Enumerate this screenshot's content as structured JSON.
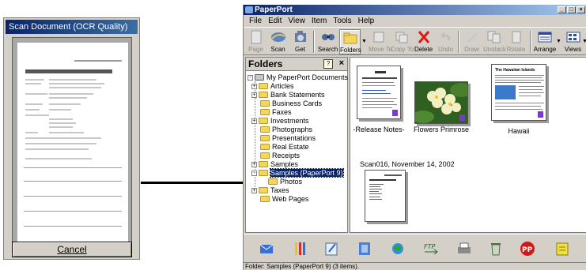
{
  "scan_dialog": {
    "title": "Scan Document (OCR Quality)",
    "cancel_label": "Cancel"
  },
  "paperport": {
    "window_title": "PaperPort",
    "window_buttons": [
      "_",
      "□",
      "×"
    ],
    "menu": [
      "File",
      "Edit",
      "View",
      "Item",
      "Tools",
      "Help"
    ],
    "toolbar": {
      "page": "Page",
      "scan": "Scan",
      "get": "Get",
      "search": "Search",
      "folders": "Folders",
      "move_to": "Move To",
      "copy_to": "Copy To",
      "delete": "Delete",
      "undo": "Undo",
      "draw": "Draw",
      "unstack": "Unstack",
      "rotate": "Rotate",
      "arrange": "Arrange",
      "views": "Views"
    },
    "folders_pane": {
      "title": "Folders",
      "help": "?",
      "close": "×",
      "root": "My PaperPort Documents",
      "items": [
        {
          "label": "Articles",
          "expander": "+"
        },
        {
          "label": "Bank Statements",
          "expander": "+"
        },
        {
          "label": "Business Cards",
          "expander": ""
        },
        {
          "label": "Faxes",
          "expander": ""
        },
        {
          "label": "Investments",
          "expander": "+"
        },
        {
          "label": "Photographs",
          "expander": ""
        },
        {
          "label": "Presentations",
          "expander": ""
        },
        {
          "label": "Real Estate",
          "expander": ""
        },
        {
          "label": "Receipts",
          "expander": ""
        },
        {
          "label": "Samples",
          "expander": "+"
        },
        {
          "label": "Samples (PaperPort 9)",
          "expander": "-",
          "selected": true
        },
        {
          "label": "Photos",
          "expander": "",
          "child": true
        },
        {
          "label": "Taxes",
          "expander": "+"
        },
        {
          "label": "Web Pages",
          "expander": ""
        }
      ]
    },
    "desktop": {
      "items": [
        {
          "caption": "-Release Notes-"
        },
        {
          "caption": "Flowers Primrose"
        },
        {
          "caption": "Hawaii",
          "doc_title": "The Hawaiian Islands"
        }
      ],
      "scan_item_label": "Scan016, November 14, 2002"
    },
    "sendto_icons": [
      "outlook-icon",
      "paint-icon",
      "notepad-icon",
      "word-icon",
      "browser-icon",
      "ftp-icon",
      "printer-icon",
      "recycle-icon",
      "pdf-icon",
      "note-icon"
    ],
    "status": "Folder: Samples (PaperPort 9) (3 items)."
  }
}
